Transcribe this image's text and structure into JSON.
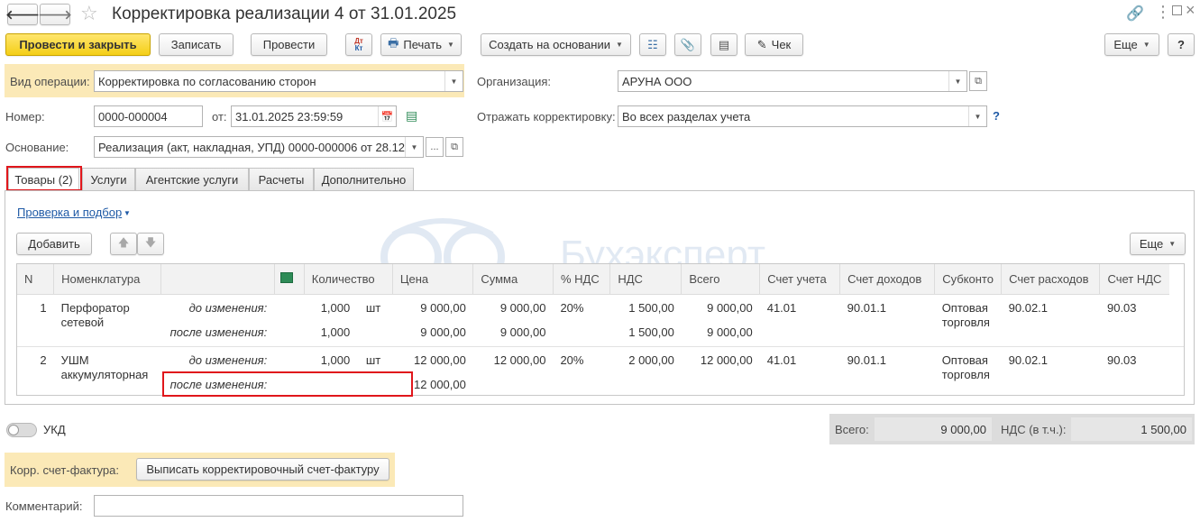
{
  "window": {
    "title": "Корректировка реализации 4 от 31.01.2025"
  },
  "toolbar": {
    "post_close": "Провести и закрыть",
    "save": "Записать",
    "post": "Провести",
    "dt_kt": "Дт Кт",
    "print": "Печать",
    "create_based": "Создать на основании",
    "check": "Чек",
    "more": "Еще",
    "help": "?"
  },
  "form": {
    "op_type_label": "Вид операции:",
    "op_type_value": "Корректировка по согласованию сторон",
    "org_label": "Организация:",
    "org_value": "АРУНА ООО",
    "number_label": "Номер:",
    "number_value": "0000-000004",
    "date_label": "от:",
    "date_value": "31.01.2025 23:59:59",
    "reflect_label": "Отражать корректировку:",
    "reflect_value": "Во всех разделах учета",
    "reflect_help": "?",
    "basis_label": "Основание:",
    "basis_value": "Реализация (акт, накладная, УПД) 0000-000006 от 28.12.",
    "basis_dots": "..."
  },
  "tabs": [
    {
      "label": "Товары (2)"
    },
    {
      "label": "Услуги"
    },
    {
      "label": "Агентские услуги"
    },
    {
      "label": "Расчеты"
    },
    {
      "label": "Дополнительно"
    }
  ],
  "goods": {
    "check_link": "Проверка и подбор",
    "add": "Добавить",
    "more": "Еще",
    "watermark": "Бухэксперт",
    "columns": [
      "N",
      "Номенклатура",
      "",
      "",
      "Количество",
      "Цена",
      "Сумма",
      "% НДС",
      "НДС",
      "Всего",
      "Счет учета",
      "Счет доходов",
      "Субконто",
      "Счет расходов",
      "Счет НДС"
    ],
    "rows": [
      {
        "n": "1",
        "name": "Перфоратор сетевой",
        "before": {
          "label": "до изменения:",
          "qty": "1,000",
          "unit": "шт",
          "price": "9 000,00",
          "sum": "9 000,00",
          "vat_rate": "20%",
          "vat": "1 500,00",
          "total": "9 000,00",
          "account": "41.01",
          "income": "90.01.1",
          "subconto": "Оптовая торговля",
          "expense": "90.02.1",
          "vat_account": "90.03"
        },
        "after": {
          "label": "после изменения:",
          "qty": "1,000",
          "price": "9 000,00",
          "sum": "9 000,00",
          "vat": "1 500,00",
          "total": "9 000,00"
        }
      },
      {
        "n": "2",
        "name": "УШМ аккумуляторная",
        "before": {
          "label": "до изменения:",
          "qty": "1,000",
          "unit": "шт",
          "price": "12 000,00",
          "sum": "12 000,00",
          "vat_rate": "20%",
          "vat": "2 000,00",
          "total": "12 000,00",
          "account": "41.01",
          "income": "90.01.1",
          "subconto": "Оптовая торговля",
          "expense": "90.02.1",
          "vat_account": "90.03"
        },
        "after": {
          "label": "после изменения:",
          "qty": "",
          "price": "12 000,00",
          "sum": "",
          "vat": "",
          "total": ""
        }
      }
    ]
  },
  "footer": {
    "ukd": "УКД",
    "total_label": "Всего:",
    "total_value": "9 000,00",
    "vat_label": "НДС (в т.ч.):",
    "vat_value": "1 500,00",
    "corr_label": "Корр. счет-фактура:",
    "corr_button": "Выписать корректировочный счет-фактуру",
    "comment_label": "Комментарий:",
    "comment_value": ""
  },
  "colors": {
    "primary_button": "#f4cf16",
    "highlight_bg": "#fbe9b7",
    "red_frame": "#e0161b",
    "note_text": "#a37f37",
    "link": "#1f5aa6"
  }
}
